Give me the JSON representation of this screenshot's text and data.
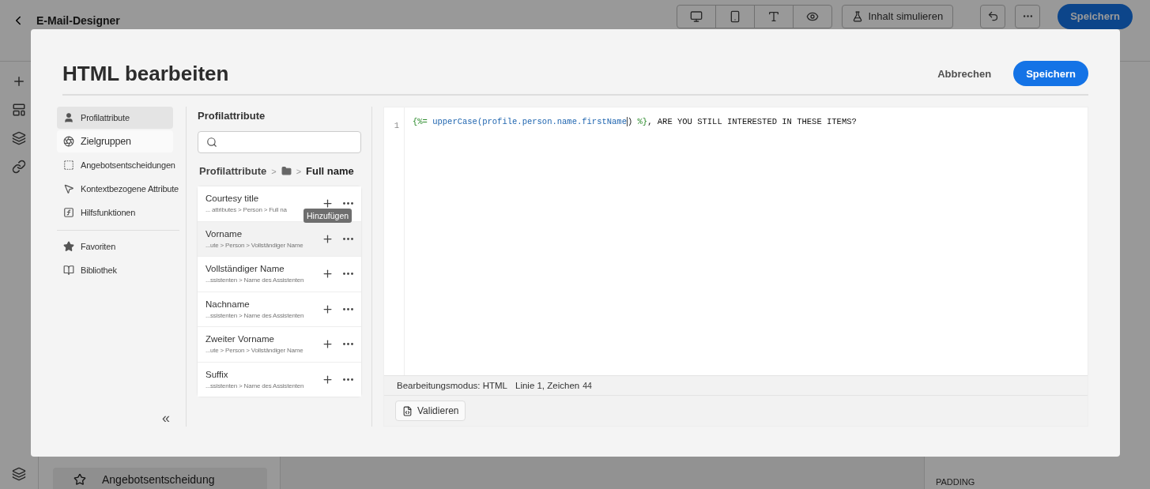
{
  "app": {
    "title": "E-Mail-Designer",
    "simulate_button": "Inhalt simulieren",
    "save_button": "Speichern",
    "offer_card": "Angebotsentscheidung",
    "padding_label": "PADDING"
  },
  "dialog": {
    "title": "HTML bearbeiten",
    "cancel": "Abbrechen",
    "save": "Speichern",
    "nav": [
      {
        "label": "Profilattribute",
        "selected": true,
        "hovered": false
      },
      {
        "label": "Zielgruppen",
        "selected": false,
        "hovered": true
      },
      {
        "label": "Angebotsentscheidungen",
        "selected": false,
        "hovered": false
      },
      {
        "label": "Kontextbezogene Attribute",
        "selected": false,
        "hovered": false
      },
      {
        "label": "Hilfsfunktionen",
        "selected": false,
        "hovered": false
      },
      {
        "label": "Favoriten",
        "selected": false,
        "hovered": false
      },
      {
        "label": "Bibliothek",
        "selected": false,
        "hovered": false
      }
    ],
    "collapse": "«",
    "attributes": {
      "heading": "Profilattribute",
      "breadcrumb": {
        "root": "Profilattribute",
        "separator": ">",
        "current": "Full name"
      },
      "items": [
        {
          "title": "Courtesy title",
          "path": "... attributes > Person > Full na",
          "selected": false
        },
        {
          "title": "Vorname",
          "path": "...ute > Person > Vollständiger Name",
          "selected": true,
          "tooltip": "Hinzufügen"
        },
        {
          "title": "Vollständiger Name",
          "path": "...ssistenten > Name des Assistenten",
          "selected": false
        },
        {
          "title": "Nachname",
          "path": "...ssistenten > Name des Assistenten",
          "selected": false
        },
        {
          "title": "Zweiter Vorname",
          "path": "...ute > Person > Vollständiger Name",
          "selected": false
        },
        {
          "title": "Suffix",
          "path": "...ssistenten > Name des Assistenten",
          "selected": false
        }
      ]
    },
    "editor": {
      "line_number": "1",
      "code": [
        {
          "kind": "delimiter",
          "text": "{%="
        },
        {
          "kind": "function",
          "text": " upperCase(profile.person.name.firstName"
        },
        {
          "kind": "plain",
          "text": ")"
        },
        {
          "kind": "delimiter",
          "text": " %}"
        },
        {
          "kind": "plain",
          "text": ", ARE YOU STILL INTERESTED IN THESE ITEMS?"
        }
      ],
      "mode": "Bearbeitungsmodus: HTML",
      "position": "Linie 1, Zeichen",
      "position_value": "44",
      "validate": "Validieren"
    }
  }
}
